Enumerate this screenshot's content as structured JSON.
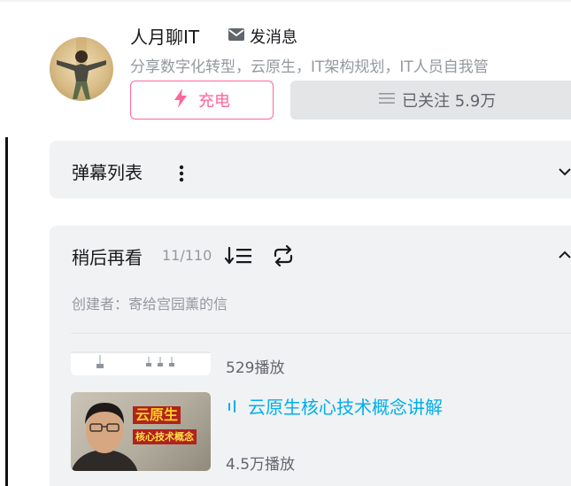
{
  "profile": {
    "username": "人月聊IT",
    "message_label": "发消息",
    "signature": "分享数字化转型，云原生，IT架构规划，IT人员自我管",
    "charge_label": "充电",
    "follow_label": "已关注 5.9万"
  },
  "danmaku": {
    "title": "弹幕列表"
  },
  "watch_later": {
    "title": "稍后再看",
    "count": "11/110",
    "creator": "创建者：寄给宫园薰的信",
    "items": [
      {
        "plays": "529播放"
      },
      {
        "title": "云原生核心技术概念讲解",
        "plays": "4.5万播放",
        "thumb_text_main": "云原生",
        "thumb_text_sub": "核心技术概念"
      }
    ]
  },
  "colors": {
    "accent_pink": "#ff6699",
    "active_blue": "#00aeec",
    "panel_bg": "#f1f2f3"
  },
  "icons": [
    "envelope-icon",
    "lightning-icon",
    "list-icon",
    "kebab-icon",
    "chevron-down-icon",
    "chevron-up-icon",
    "sort-order-icon",
    "loop-icon",
    "now-playing-icon"
  ]
}
